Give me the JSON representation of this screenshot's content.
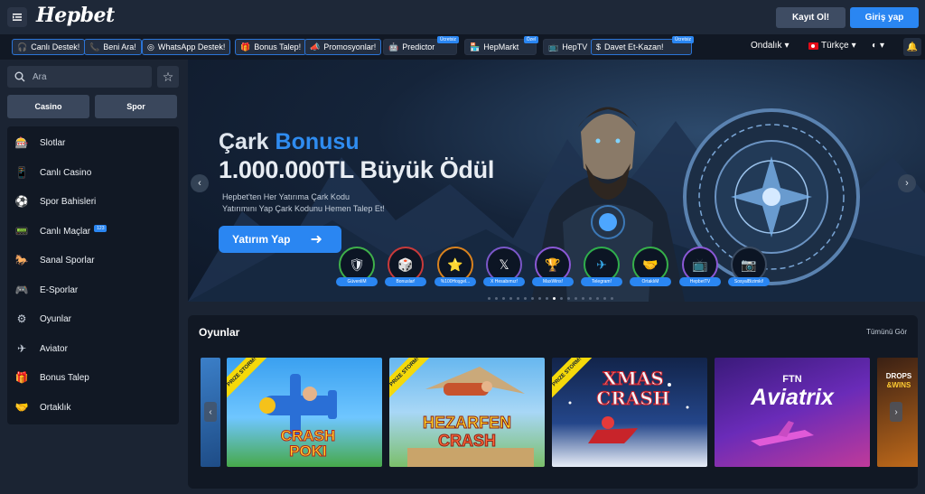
{
  "header": {
    "logo": "Hepbet",
    "register_label": "Kayıt Ol!",
    "login_label": "Giriş yap"
  },
  "subnav": {
    "items": [
      {
        "label": "Canlı Destek!",
        "icon": "headset-icon"
      },
      {
        "label": "Beni Ara!",
        "icon": "phone-icon"
      },
      {
        "label": "WhatsApp Destek!",
        "icon": "whatsapp-icon"
      },
      {
        "label": "Bonus Talep!",
        "icon": "gift-icon"
      },
      {
        "label": "Promosyonlar!",
        "icon": "megaphone-icon"
      },
      {
        "label": "Predictor",
        "icon": "robot-icon",
        "badge": "Ücretsiz"
      },
      {
        "label": "HepMarkt",
        "icon": "store-icon",
        "badge": "Özel"
      },
      {
        "label": "HepTV",
        "icon": "tv-icon"
      },
      {
        "label": "Davet Et-Kazan!",
        "icon": "coin-icon",
        "badge": "Ücretsiz"
      }
    ],
    "odds_format": "Ondalık",
    "language": "Türkçe",
    "theme_icon": "half-moon-icon"
  },
  "sidebar": {
    "search_placeholder": "Ara",
    "tabs": [
      "Casino",
      "Spor"
    ],
    "items": [
      {
        "label": "Slotlar",
        "icon": "slot-machine-icon"
      },
      {
        "label": "Canlı Casino",
        "icon": "mobile-cards-icon"
      },
      {
        "label": "Spor Bahisleri",
        "icon": "football-icon"
      },
      {
        "label": "Canlı Maçlar",
        "icon": "live-match-icon",
        "badge": "123"
      },
      {
        "label": "Sanal Sporlar",
        "icon": "horse-icon"
      },
      {
        "label": "E-Sporlar",
        "icon": "gamepad-icon"
      },
      {
        "label": "Oyunlar",
        "icon": "gear-icon"
      },
      {
        "label": "Aviator",
        "icon": "airplane-icon"
      },
      {
        "label": "Bonus Talep",
        "icon": "bonus-icon"
      },
      {
        "label": "Ortaklık",
        "icon": "handshake-icon"
      }
    ]
  },
  "hero": {
    "title_part1": "Çark ",
    "title_part2": "Bonusu",
    "headline": "1.000.000TL Büyük Ödül",
    "subtitle_line1": "Hepbet'ten Her Yatırıma Çark Kodu",
    "subtitle_line2": "Yatırımını Yap Çark Kodunu Hemen Talep Et!",
    "cta_label": "Yatırım Yap",
    "quick_links": [
      {
        "label": "GüvenliM",
        "icon": "shield-icon"
      },
      {
        "label": "Bonuslar!",
        "icon": "dice-icon"
      },
      {
        "label": "%100Hoşgel...",
        "icon": "star-icon"
      },
      {
        "label": "X Hesabımız!",
        "icon": "x-logo-icon"
      },
      {
        "label": "MaxWins!",
        "icon": "trophy-icon"
      },
      {
        "label": "Telegram!",
        "icon": "telegram-icon"
      },
      {
        "label": "OrtaklıM",
        "icon": "handshake-icon"
      },
      {
        "label": "HepbetTV",
        "icon": "tv-icon"
      },
      {
        "label": "SosyalBizimki!",
        "icon": "social-icon"
      }
    ],
    "active_slide": 9,
    "slide_count": 18
  },
  "games": {
    "title": "Oyunlar",
    "see_all": "Tümünü Gör",
    "items": [
      {
        "name_line1": "CRASH",
        "name_line2": "POKI",
        "ribbon": "PRIZE STORM!"
      },
      {
        "name_line1": "HEZARFEN",
        "name_line2": "CRASH",
        "ribbon": "PRIZE STORM!"
      },
      {
        "name_line1": "XMAS",
        "name_line2": "CRASH",
        "ribbon": "PRIZE STORM!"
      },
      {
        "name_line1": "FTN",
        "name_line2": "Aviatrix",
        "ribbon": ""
      },
      {
        "name_line1": "DROPS",
        "name_line2": "&WINS",
        "ribbon": ""
      }
    ]
  },
  "colors": {
    "accent": "#2a86f2",
    "background": "#1b2433",
    "panel": "#111824"
  }
}
